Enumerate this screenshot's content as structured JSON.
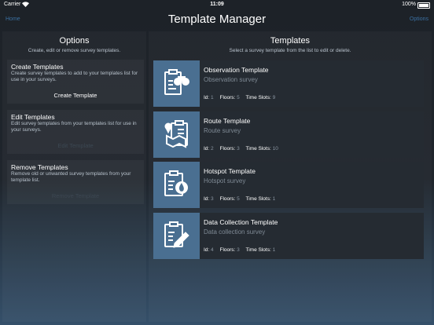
{
  "status": {
    "carrier": "Carrier",
    "time": "11:09",
    "battery": "100%"
  },
  "nav": {
    "home": "Home",
    "title": "Template Manager",
    "options": "Options"
  },
  "options_panel": {
    "title": "Options",
    "subtitle": "Create, edit or remove survey templates.",
    "cards": [
      {
        "heading": "Create Templates",
        "description": "Create survey templates to add to your templates list for use in your surveys.",
        "button": "Create Template"
      },
      {
        "heading": "Edit Templates",
        "description": "Edit survey templates from your templates list for use in your surveys.",
        "button": "Edit Template"
      },
      {
        "heading": "Remove Templates",
        "description": "Remove old or unwanted survey templates from your template list.",
        "button": "Remove Template"
      }
    ]
  },
  "templates_panel": {
    "title": "Templates",
    "subtitle": "Select a survey template from the list to edit or delete.",
    "labels": {
      "id": "Id:",
      "floors": "Floors:",
      "slots": "Time Slots:"
    },
    "items": [
      {
        "name": "Observation Template",
        "description": "Observation survey",
        "id": "1",
        "floors": "5",
        "slots": "9",
        "icon": "clipboard-binoculars-icon"
      },
      {
        "name": "Route Template",
        "description": "Route survey",
        "id": "2",
        "floors": "3",
        "slots": "10",
        "icon": "clipboard-map-pin-icon"
      },
      {
        "name": "Hotspot Template",
        "description": "Hotspot survey",
        "id": "3",
        "floors": "5",
        "slots": "1",
        "icon": "clipboard-flame-icon"
      },
      {
        "name": "Data Collection Template",
        "description": "Data collection survey",
        "id": "4",
        "floors": "3",
        "slots": "1",
        "icon": "clipboard-pencil-icon"
      }
    ]
  }
}
